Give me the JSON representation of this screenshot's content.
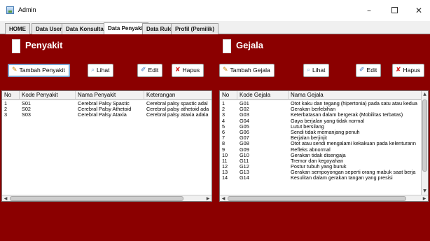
{
  "window": {
    "title": "Admin",
    "minimize_glyph": "–",
    "close_glyph": "✕"
  },
  "tabs": [
    {
      "label": "HOME"
    },
    {
      "label": "Data User"
    },
    {
      "label": "Data Konsultasi"
    },
    {
      "label": "Data Penyakit",
      "active": true
    },
    {
      "label": "Data Rule"
    },
    {
      "label": "Profil (Pemilik)"
    }
  ],
  "colors": {
    "background": "#8b0000",
    "active_tab": "#ffffff"
  },
  "penyakit_panel": {
    "title": "Penyakit",
    "buttons": {
      "add": {
        "label": "Tambah Penyakit",
        "icon": "pencil-icon"
      },
      "view": {
        "label": "Lihat",
        "icon": "search-icon"
      },
      "edit": {
        "label": "Edit",
        "icon": "edit-icon"
      },
      "delete": {
        "label": "Hapus",
        "icon": "delete-icon"
      }
    },
    "table": {
      "columns": [
        "No",
        "Kode Penyakit",
        "Nama Penyakit",
        "Keterangan"
      ],
      "rows": [
        [
          "1",
          "S01",
          "Cerebral Palsy Spastic",
          "Cerebral palsy spastic adal"
        ],
        [
          "2",
          "S02",
          "Cerebral Palsy Athetoid",
          "Cerebral palsy athetoid ada"
        ],
        [
          "3",
          "S03",
          "Cerebral Palsy Ataxia",
          "Cerebral palsy ataxia adala"
        ]
      ]
    }
  },
  "gejala_panel": {
    "title": "Gejala",
    "buttons": {
      "add": {
        "label": "Tambah Gejala",
        "icon": "pencil-icon"
      },
      "view": {
        "label": "Lihat",
        "icon": "search-icon"
      },
      "edit": {
        "label": "Edit",
        "icon": "edit-icon"
      },
      "delete": {
        "label": "Hapus",
        "icon": "delete-icon"
      }
    },
    "table": {
      "columns": [
        "No",
        "Kode Gejala",
        "Nama Gejala"
      ],
      "rows": [
        [
          "1",
          "G01",
          "Otot kaku dan tegang (hipertonia) pada satu atau kedua"
        ],
        [
          "2",
          "G02",
          "Gerakan berlebihan"
        ],
        [
          "3",
          "G03",
          "Keterbatasan dalam bergerak (Mobilitas terbatas)"
        ],
        [
          "4",
          "G04",
          "Gaya berjalan yang tidak normal"
        ],
        [
          "5",
          "G05",
          "Lutut bersilang"
        ],
        [
          "6",
          "G06",
          "Sendi tidak memanjang penuh"
        ],
        [
          "7",
          "G07",
          "Berjalan berjinjit"
        ],
        [
          "8",
          "G08",
          "Otot atau sendi mengalami kekakuan pada kelenturann"
        ],
        [
          "9",
          "G09",
          "Refleks abnormal"
        ],
        [
          "10",
          "G10",
          "Gerakan tidak disengaja"
        ],
        [
          "11",
          "G11",
          "Tremor dan kegoyahan"
        ],
        [
          "12",
          "G12",
          "Postur tubuh yang buruk"
        ],
        [
          "13",
          "G13",
          "Gerakan sempoyongan seperti orang mabuk saat berja"
        ],
        [
          "14",
          "G14",
          "Kesulitan dalam gerakan tangan yang presisi"
        ]
      ]
    }
  }
}
